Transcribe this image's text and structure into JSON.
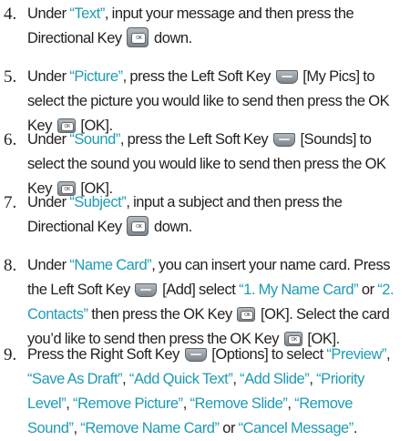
{
  "steps": [
    {
      "number": "4.",
      "parts": [
        {
          "t": "Under "
        },
        {
          "h": "“Text”"
        },
        {
          "t": ", input your message and then press the Directional Key "
        },
        {
          "icon": "directional-key-icon"
        },
        {
          "t": " down."
        }
      ]
    },
    {
      "number": "5.",
      "parts": [
        {
          "t": "Under "
        },
        {
          "h": "“Picture”"
        },
        {
          "t": ", press the Left Soft Key "
        },
        {
          "icon": "left-soft-key-icon"
        },
        {
          "t": " [My Pics] to select the picture you would like to send then press the OK Key "
        },
        {
          "icon": "ok-key-icon"
        },
        {
          "t": " [OK]."
        }
      ]
    },
    {
      "number": "6.",
      "parts": [
        {
          "t": "Under "
        },
        {
          "h": "“Sound”"
        },
        {
          "t": ", press the Left Soft Key "
        },
        {
          "icon": "left-soft-key-icon"
        },
        {
          "t": " [Sounds] to select the sound you would like to send then press the OK Key "
        },
        {
          "icon": "ok-key-icon"
        },
        {
          "t": " [OK]."
        }
      ]
    },
    {
      "number": "7.",
      "parts": [
        {
          "t": "Under "
        },
        {
          "h": "“Subject”"
        },
        {
          "t": ", input a subject and then press the Directional Key "
        },
        {
          "icon": "directional-key-icon"
        },
        {
          "t": " down."
        }
      ]
    },
    {
      "number": "8.",
      "parts": [
        {
          "t": "Under "
        },
        {
          "h": "“Name Card”"
        },
        {
          "t": ", you can insert your name card. Press the Left Soft Key "
        },
        {
          "icon": "left-soft-key-icon"
        },
        {
          "t": " [Add] select "
        },
        {
          "h": "“1. My Name Card”"
        },
        {
          "t": " or "
        },
        {
          "h": "“2. Contacts”"
        },
        {
          "t": " then press the OK Key "
        },
        {
          "icon": "ok-key-icon"
        },
        {
          "t": " [OK]. Select the card you’d like to send then press the OK Key "
        },
        {
          "icon": "ok-key-icon"
        },
        {
          "t": " [OK]."
        }
      ]
    },
    {
      "number": "9.",
      "parts": [
        {
          "t": "Press the Right Soft Key "
        },
        {
          "icon": "right-soft-key-icon"
        },
        {
          "t": " [Options] to select "
        },
        {
          "h": "“Preview”"
        },
        {
          "t": ", "
        },
        {
          "h": "“Save As Draft”"
        },
        {
          "t": ", "
        },
        {
          "h": "“Add Quick Text”"
        },
        {
          "t": ", "
        },
        {
          "h": "“Add Slide”"
        },
        {
          "t": ", "
        },
        {
          "h": "“Priority Level”"
        },
        {
          "t": ", "
        },
        {
          "h": "“Remove Picture”"
        },
        {
          "t": ", "
        },
        {
          "h": "“Remove Slide”"
        },
        {
          "t": ", "
        },
        {
          "h": "“Remove Sound”"
        },
        {
          "t": ", "
        },
        {
          "h": "“Remove Name Card”"
        },
        {
          "t": " or "
        },
        {
          "h": "“Cancel Message”"
        },
        {
          "t": "."
        }
      ]
    }
  ],
  "colors": {
    "highlight": "#1e9bb4",
    "text": "#231f20"
  }
}
